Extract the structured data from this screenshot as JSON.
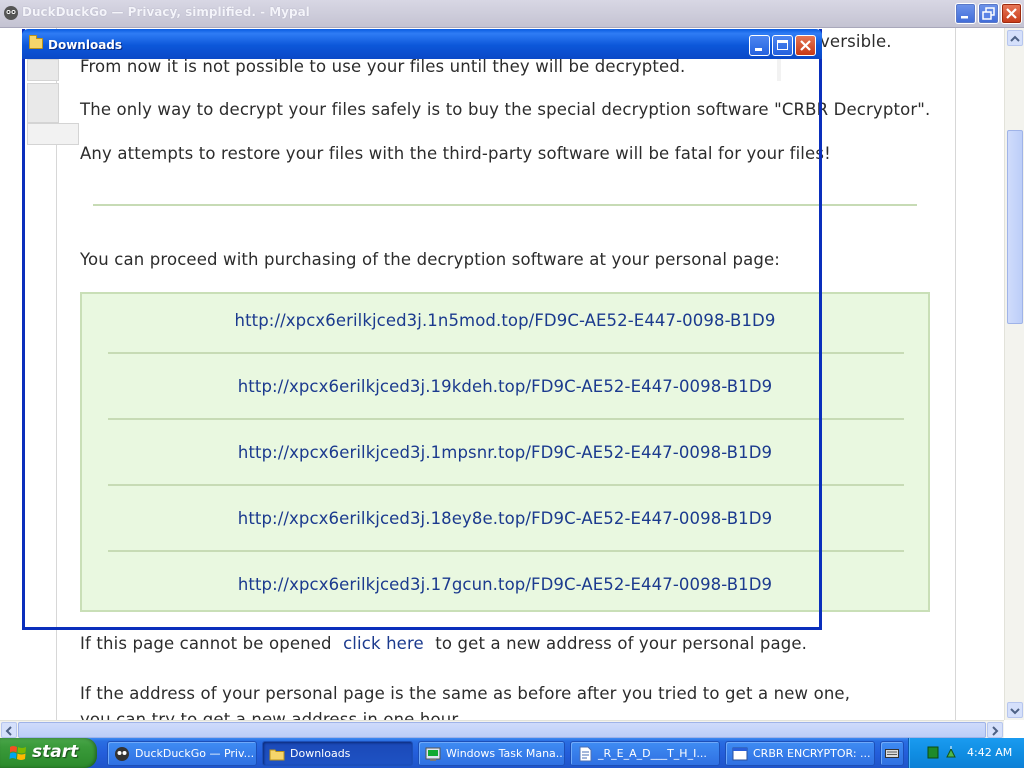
{
  "browser": {
    "title": "DuckDuckGo — Privacy, simplified. - Mypal"
  },
  "page": {
    "partial_top_right": "versible.",
    "line1": "From now it is not possible to use your files until they will be decrypted.",
    "line2": "The only way to decrypt your files safely is to buy the special decryption software \"CRBR Decryptor\".",
    "line3": "Any attempts to restore your files with the third-party software will be fatal for your files!",
    "proceed_text": "You can proceed with purchasing of the decryption software at your personal page:",
    "links": [
      "http://xpcx6erilkjced3j.1n5mod.top/FD9C-AE52-E447-0098-B1D9",
      "http://xpcx6erilkjced3j.19kdeh.top/FD9C-AE52-E447-0098-B1D9",
      "http://xpcx6erilkjced3j.1mpsnr.top/FD9C-AE52-E447-0098-B1D9",
      "http://xpcx6erilkjced3j.18ey8e.top/FD9C-AE52-E447-0098-B1D9",
      "http://xpcx6erilkjced3j.17gcun.top/FD9C-AE52-E447-0098-B1D9"
    ],
    "cannot_open_before": "If this page cannot be opened ",
    "click_here": "click here",
    "cannot_open_after": " to get a new address of your personal page.",
    "same_address_line1": "If the address of your personal page is the same as before after you tried to get a new one,",
    "same_address_line2": "you can try to get a new address in one hour."
  },
  "downloads_window": {
    "title": "Downloads"
  },
  "taskbar": {
    "start_label": "start",
    "tasks": [
      {
        "label": "DuckDuckGo — Priv...",
        "icon": "mypal-icon"
      },
      {
        "label": "Downloads",
        "icon": "folder-icon"
      },
      {
        "label": "Windows Task Mana...",
        "icon": "task-manager-icon"
      },
      {
        "label": "_R_E_A_D___T_H_I...",
        "icon": "document-icon"
      },
      {
        "label": "CRBR ENCRYPTOR: ...",
        "icon": "window-icon"
      }
    ],
    "clock": "4:42 AM"
  },
  "colors": {
    "link": "#1b3a8e",
    "box_bg": "#e9f8e0",
    "box_border": "#c9dfb7",
    "taskbar": "#245edb",
    "start_green": "#3a9a3a"
  }
}
